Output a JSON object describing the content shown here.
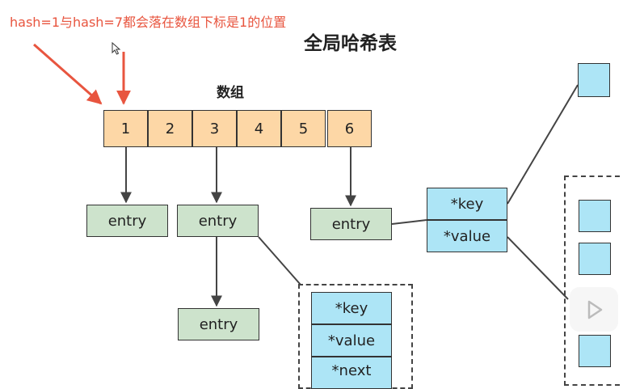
{
  "annotation": "hash=1与hash=7都会落在数组下标是1的位置",
  "title": "全局哈希表",
  "array": {
    "label": "数组",
    "cells": [
      "1",
      "2",
      "3",
      "4",
      "5",
      "6"
    ]
  },
  "entries": [
    "entry",
    "entry",
    "entry",
    "entry"
  ],
  "node_right": {
    "key": "*key",
    "value": "*value"
  },
  "node_bottom": {
    "key": "*key",
    "value": "*value",
    "next": "*next"
  },
  "colors": {
    "annotation": "#e8553f",
    "array_cell": "#fdd7a6",
    "entry": "#cde3cc",
    "field": "#ade5f6"
  },
  "icons": [
    "cursor-icon",
    "play-icon"
  ]
}
